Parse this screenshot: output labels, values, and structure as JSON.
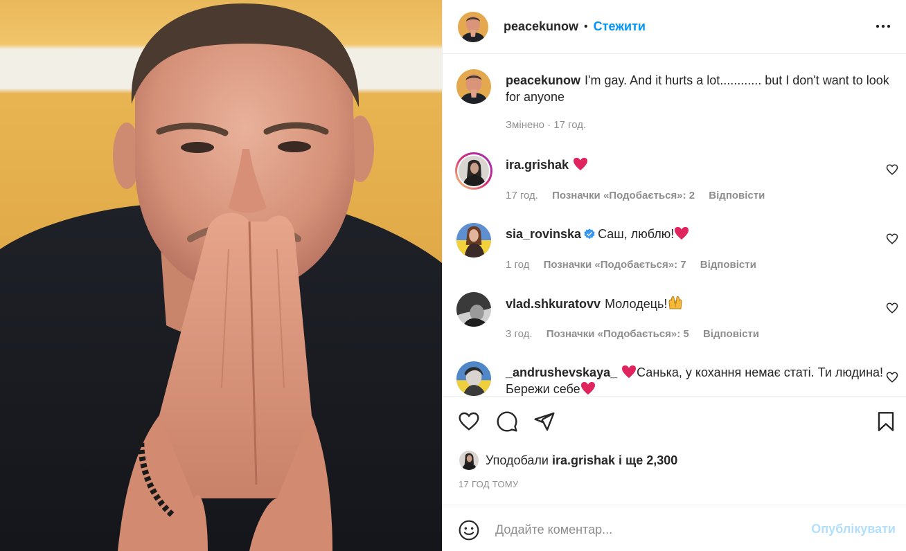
{
  "post": {
    "author": "peacekunow",
    "follow_label": "Стежити",
    "separator": "•",
    "caption": "I'm gay. And it hurts a lot............ but I don't want to look for anyone",
    "caption_meta": "Змінено · 17 год."
  },
  "comments": [
    {
      "user": "ira.grishak",
      "text": "",
      "emoji": "heart",
      "time": "17 год.",
      "likes": "Позначки «Подобається»: 2",
      "reply": "Відповісти",
      "verified": false
    },
    {
      "user": "sia_rovinska",
      "text": "Саш, люблю!",
      "emoji": "heart",
      "time": "1 год",
      "likes": "Позначки «Подобається»: 7",
      "reply": "Відповісти",
      "verified": true
    },
    {
      "user": "vlad.shkuratovv",
      "text": "Молодець!",
      "emoji": "raised-hands",
      "time": "3 год.",
      "likes": "Позначки «Подобається»: 5",
      "reply": "Відповісти",
      "verified": false
    },
    {
      "user": "_andrushevskaya_",
      "text": "Санька, у кохання немає статі. Ти людина! Бережи себе",
      "emoji": "heart",
      "verified": false
    }
  ],
  "likes_summary": {
    "prefix": "Уподобали",
    "user": "ira.grishak",
    "suffix": "і ще 2,300"
  },
  "time_ago": "17 ГОД ТОМУ",
  "comment_box": {
    "placeholder": "Додайте коментар...",
    "publish_label": "Опублікувати"
  },
  "colors": {
    "accent": "#0095f6",
    "publish_disabled": "#b2dffc",
    "muted": "#8e8e8e",
    "heart_emoji": "#e0245e",
    "story_ring": "#d62976"
  },
  "icons": [
    "more-icon",
    "heart-icon",
    "comment-icon",
    "share-icon",
    "bookmark-icon",
    "smile-icon",
    "verified-icon"
  ]
}
